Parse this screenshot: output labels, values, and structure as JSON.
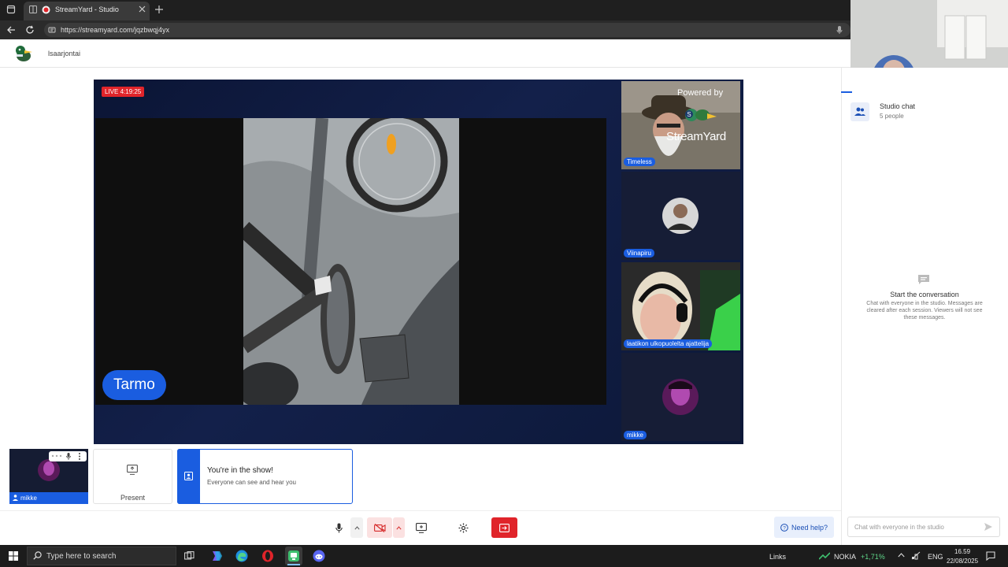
{
  "browser": {
    "tab_title": "StreamYard - Studio",
    "url": "https://streamyard.com/jqzbwqj4yx"
  },
  "header": {
    "broadcast_name": "lsaarjontai"
  },
  "stage": {
    "live_badge": "LIVE 4:19:25",
    "main_name_tag": "Tarmo",
    "powered_by": "Powered by",
    "brand": "StreamYard",
    "tiles": [
      {
        "label": "Timeless"
      },
      {
        "label": "Viinapiru"
      },
      {
        "label": "laatikon ulkopuolelta ajattelija"
      },
      {
        "label": "mikke"
      }
    ]
  },
  "bottom": {
    "self_label": "mikke",
    "present_label": "Present",
    "show_title": "You're in the show!",
    "show_desc": "Everyone can see and hear you"
  },
  "controls": {
    "help_label": "Need help?"
  },
  "chat": {
    "title": "Studio chat",
    "subtitle": "5 people",
    "empty_title": "Start the conversation",
    "empty_desc": "Chat with everyone in the studio. Messages are cleared after each session. Viewers will not see these messages.",
    "input_placeholder": "Chat with everyone in the studio"
  },
  "taskbar": {
    "search_placeholder": "Type here to search",
    "links_label": "Links",
    "stock_name": "NOKIA",
    "stock_change": "+1,71%",
    "language": "ENG",
    "time": "16.59",
    "date": "22/08/2025"
  },
  "colors": {
    "brand_blue": "#1a5de0",
    "live_red": "#e0242a",
    "leave_red": "#e0242a",
    "stage_navy": "#0b1535"
  }
}
